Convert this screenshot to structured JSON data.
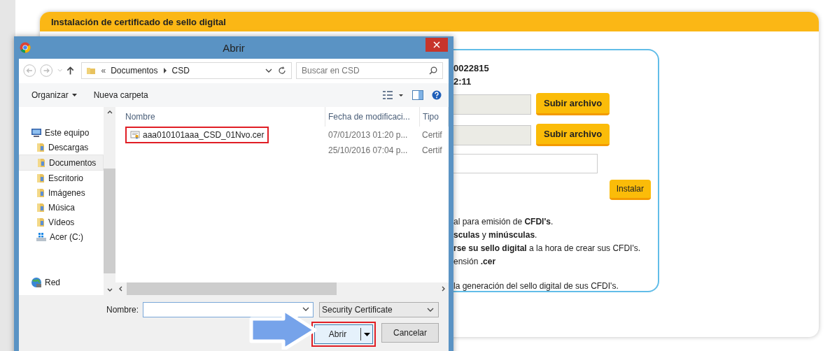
{
  "page": {
    "title": "Instalación de certificado de sello digital",
    "fragments": [
      "0022815",
      "2:11"
    ],
    "upload_buttons": [
      "Subir archivo",
      "Subir archivo"
    ],
    "install_button": "Instalar",
    "notes": [
      "al para emisión de **CFDI's**.",
      "**sculas** y **minúsculas**.",
      "**rse su sello digital** a la hora de crear sus CFDI's.",
      "ensión **.cer**",
      "la generación del sello digital de sus CFDI's."
    ]
  },
  "dialog": {
    "title": "Abrir",
    "path_prefix": "«",
    "path": [
      "Documentos",
      "CSD"
    ],
    "search": {
      "placeholder": "Buscar en CSD"
    },
    "toolbar": [
      "Organizar",
      "Nueva carpeta"
    ],
    "sidebar": {
      "items": [
        {
          "label": "Este equipo",
          "kind": "computer",
          "selected": false,
          "children": [
            {
              "label": "Descargas",
              "kind": "folder",
              "selected": false
            },
            {
              "label": "Documentos",
              "kind": "folder",
              "selected": true
            },
            {
              "label": "Escritorio",
              "kind": "folder",
              "selected": false
            },
            {
              "label": "Imágenes",
              "kind": "folder",
              "selected": false
            },
            {
              "label": "Música",
              "kind": "folder",
              "selected": false
            },
            {
              "label": "Vídeos",
              "kind": "folder",
              "selected": false
            },
            {
              "label": "Acer (C:)",
              "kind": "drive",
              "selected": false
            }
          ]
        },
        {
          "label": "Red",
          "kind": "network",
          "selected": false
        }
      ]
    },
    "columns": [
      "Nombre",
      "Fecha de modificaci...",
      "Tipo"
    ],
    "files": [
      {
        "name": "aaa010101aaa_CSD_01Nvo.cer",
        "date": "07/01/2013 01:20 p...",
        "type": "Certif",
        "highlighted": true
      },
      {
        "date": "25/10/2016 07:04 p...",
        "type": "Certif",
        "highlighted": false
      }
    ],
    "name_label": "Nombre:",
    "file_type": "Security Certificate",
    "buttons": [
      {
        "label": "Abrir",
        "kind": "split",
        "highlighted": true
      },
      {
        "label": "Cancelar",
        "kind": "plain",
        "highlighted": false
      }
    ]
  }
}
